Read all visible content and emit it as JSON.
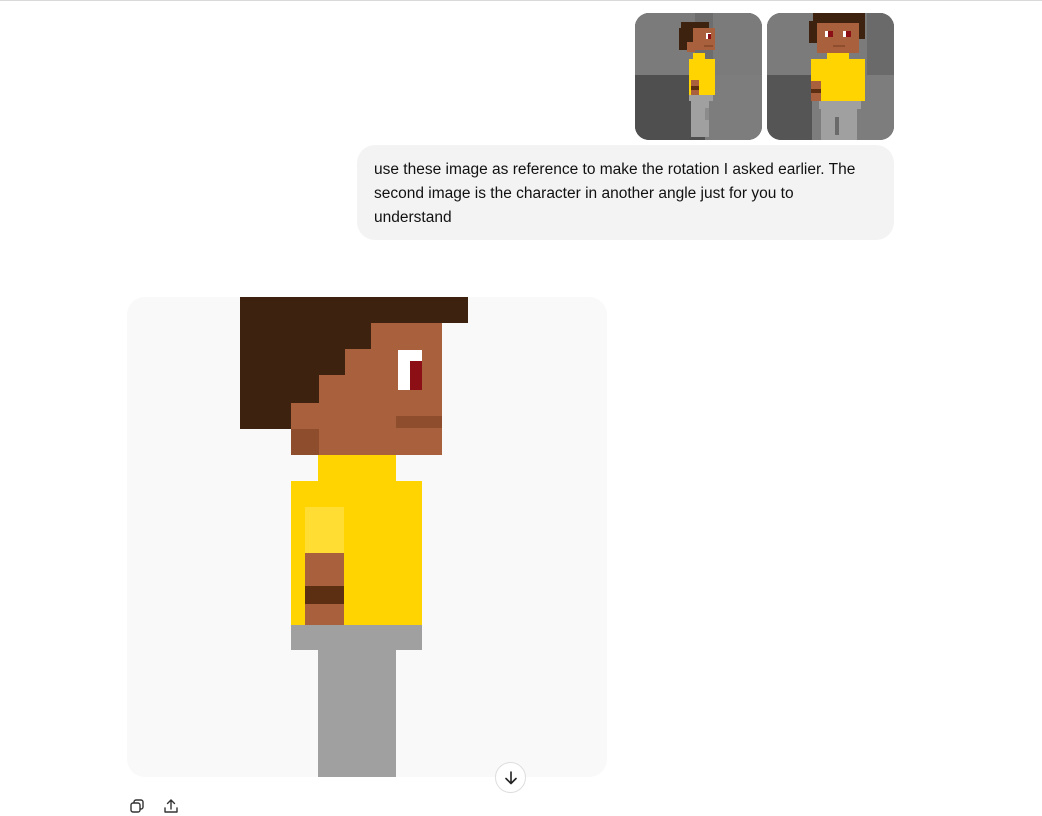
{
  "conversation": {
    "user_message": {
      "text": "use these image as reference to make the rotation I asked earlier. The second image is the character in another angle just for you to understand",
      "attachments": [
        {
          "name": "character-side-reference"
        },
        {
          "name": "character-three-quarter-reference"
        }
      ]
    },
    "assistant_message": {
      "generated_image": {
        "subject": "pixel-art character side view"
      },
      "actions": [
        "copy",
        "share"
      ]
    }
  },
  "controls": {
    "scroll_down": "scroll-to-bottom"
  },
  "icons": {
    "copy": "copy-icon",
    "share": "share-icon",
    "scroll_down": "arrow-down-icon"
  },
  "colors": {
    "hair": "#3d2210",
    "skin": "#a8613c",
    "skin_shadow": "#8e4e2d",
    "shirt": "#ffd400",
    "shirt_highlight": "#ffdd33",
    "wristband": "#5c2f12",
    "pants": "#a0a0a0",
    "eye_white": "#ffffff",
    "eye_pupil": "#8b0f14",
    "image_background": "#f9f9f9",
    "bubble_background": "#f3f3f3"
  }
}
